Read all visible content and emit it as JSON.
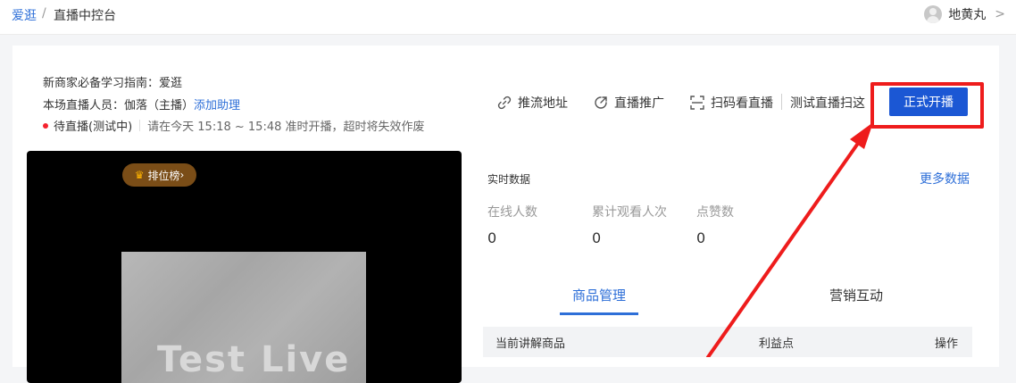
{
  "breadcrumb": {
    "root": "爱逛",
    "separator": "/",
    "current": "直播中控台"
  },
  "user": {
    "name": "地黄丸",
    "chevron": ">"
  },
  "info": {
    "guide_label": "新商家必备学习指南：爱逛",
    "staff_label": "本场直播人员：伽落（主播）",
    "add_assistant": "添加助理",
    "status": "待直播(测试中)",
    "tip": "请在今天 15:18 ~ 15:48 准时开播，超时将失效作废"
  },
  "actions": {
    "push_url": "推流地址",
    "promote": "直播推广",
    "scan_watch": "扫码看直播",
    "test_scan": "测试直播扫这",
    "go_live": "正式开播"
  },
  "video": {
    "rank_label": "排位榜",
    "rank_chevron": "›",
    "preview_text": "Test Live"
  },
  "realtime": {
    "title": "实时数据",
    "more": "更多数据",
    "stats": [
      {
        "label": "在线人数",
        "value": "0"
      },
      {
        "label": "累计观看人次",
        "value": "0"
      },
      {
        "label": "点赞数",
        "value": "0"
      }
    ]
  },
  "tabs": [
    {
      "label": "商品管理",
      "active": true
    },
    {
      "label": "营销互动",
      "active": false
    }
  ],
  "table": {
    "columns": [
      "当前讲解商品",
      "利益点",
      "操作"
    ]
  },
  "colors": {
    "accent": "#1b57d4",
    "link": "#2e6fd8",
    "highlight": "#ee1c1c",
    "status_dot": "#f5222d"
  },
  "icons": [
    "link-icon",
    "share-icon",
    "scan-icon",
    "crown-icon",
    "chevron-right-icon"
  ]
}
